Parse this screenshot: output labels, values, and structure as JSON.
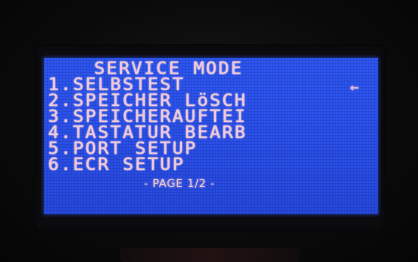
{
  "screen": {
    "title": "SERVICE MODE",
    "menu_items": [
      {
        "label": "1.SELBSTEST"
      },
      {
        "label": "2.SPEICHER LöSCH"
      },
      {
        "label": "3.SPEICHERAUFTEI"
      },
      {
        "label": "4.TASTATUR BEARB"
      },
      {
        "label": "5.PORT SETUP"
      },
      {
        "label": "6.ECR SETUP"
      }
    ],
    "selection_cursor": "←",
    "page_indicator": "- PAGE 1/2 -"
  },
  "colors": {
    "lcd_background": "#2a50ea",
    "lcd_text": "#f2c9d6",
    "bezel": "#0c0c0e"
  }
}
